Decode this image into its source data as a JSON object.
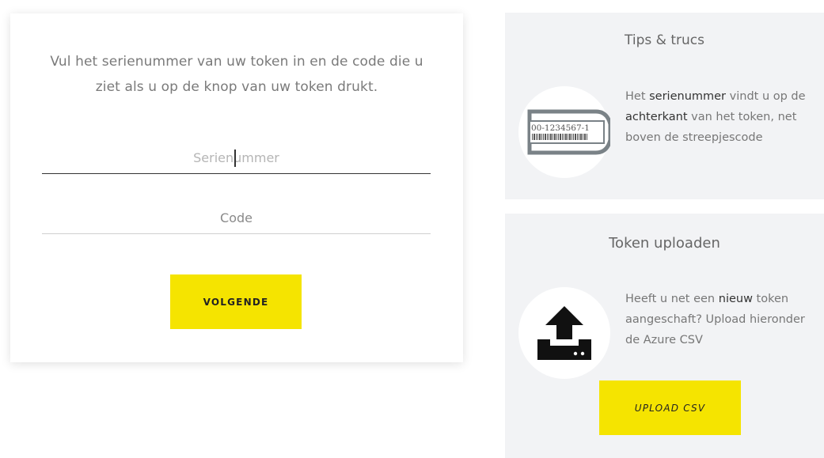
{
  "login": {
    "instruction": "Vul het serienummer van uw token in en de code die u ziet als u op de knop van uw token drukt.",
    "serial_placeholder": "Serienummer",
    "code_placeholder": "Code",
    "next_label": "VOLGENDE"
  },
  "tips": {
    "title": "Tips & trucs",
    "text_1": "Het ",
    "text_bold_1": "serienummer",
    "text_2": " vindt u op de ",
    "text_bold_2": "achterkant",
    "text_3": " van het token, net boven de streepjescode",
    "token_serial": "00-1234567-1"
  },
  "upload": {
    "title": "Token uploaden",
    "text_1": "Heeft u net een ",
    "text_bold_1": "nieuw",
    "text_2": " token aangeschaft? Upload hieronder de Azure CSV",
    "button_label": "UPLOAD CSV"
  },
  "colors": {
    "accent_yellow": "#f5e400",
    "panel_bg": "#f2f3f5"
  }
}
